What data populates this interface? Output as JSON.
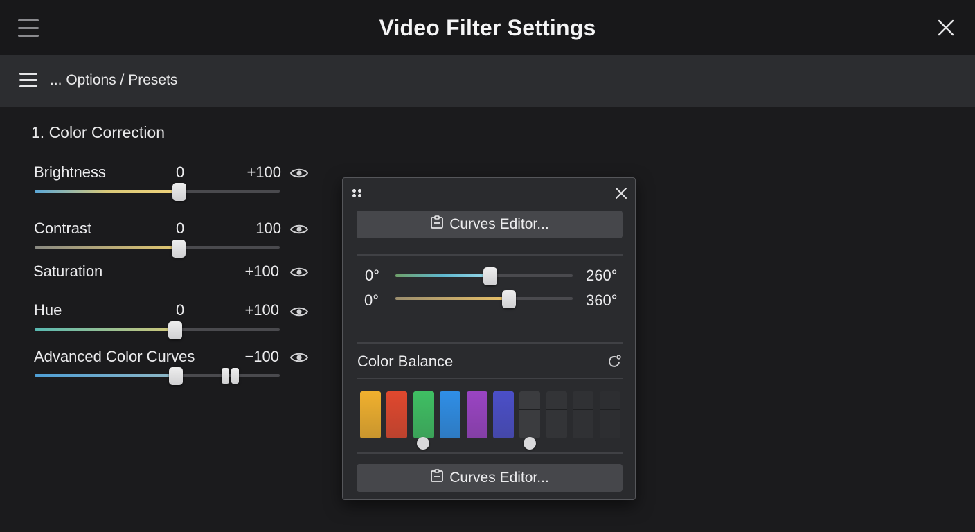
{
  "window": {
    "title": "Video Filter Settings",
    "menu_icon": "hamburger-icon",
    "close_icon": "close-icon"
  },
  "toolbar": {
    "menu_icon": "hamburger-icon",
    "breadcrumb": "... Options / Presets"
  },
  "section": {
    "title": "1. Color Correction"
  },
  "controls": [
    {
      "label": "Brightness",
      "value": "0",
      "max": "+100",
      "level": 0.59,
      "fill": "linear-gradient(90deg,#5aa7d8,#d9c979,#f1d37a)"
    },
    {
      "label": "Contrast",
      "value": "0",
      "max": "100",
      "level": 0.59,
      "fill": "linear-gradient(90deg,#8a8a82,#e3c86f)"
    },
    {
      "label": "Saturation",
      "value": "",
      "max": "+100"
    },
    {
      "label": "Hue",
      "value": "0",
      "max": "+100",
      "level": 0.57,
      "fill": "linear-gradient(90deg,#58b9b2,#d1c779)"
    },
    {
      "label": "Advanced Color Curves",
      "value": "",
      "max": "−100",
      "level": 0.58,
      "fill": "linear-gradient(90deg,#4e9fd6,#8fb7c4)"
    }
  ],
  "panel": {
    "button_top": "Curves Editor...",
    "button_bottom": "Curves Editor...",
    "sliders": [
      {
        "min": "0°",
        "max": "260°",
        "level": 0.53
      },
      {
        "min": "0°",
        "max": "360°",
        "level": 0.63
      }
    ],
    "color_balance": "Color Balance",
    "swatches": [
      "#f0b02e",
      "#e0482e",
      "#3fbf63",
      "#2f8ee6",
      "#9a44c3",
      "#4b4fc8",
      "#3b3c3f",
      "#333437",
      "#303134",
      "#2d2e31"
    ]
  },
  "colors": {
    "background": "#1b1b1d",
    "toolbar": "#2c2d30",
    "panel": "#2a2b2e"
  }
}
